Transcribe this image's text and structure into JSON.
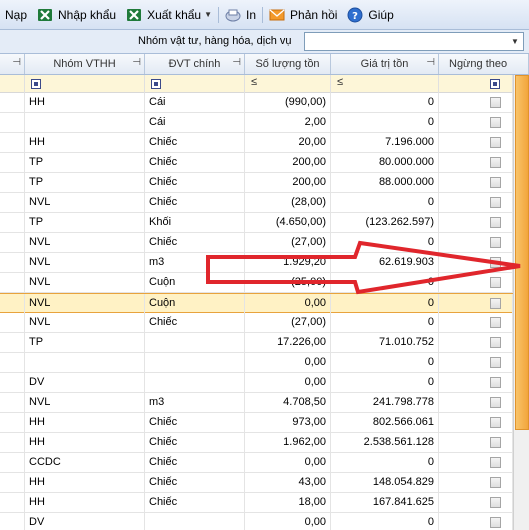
{
  "toolbar": {
    "items": [
      {
        "label": "Nạp",
        "icon": "none"
      },
      {
        "label": "Nhập khẩu",
        "icon": "excel-icon"
      },
      {
        "label": "Xuất khẩu",
        "icon": "excel-icon",
        "dropdown": true
      },
      {
        "label": "In",
        "icon": "print-icon"
      },
      {
        "label": "Phản hồi",
        "icon": "mail-icon"
      },
      {
        "label": "Giúp",
        "icon": "help-icon"
      }
    ]
  },
  "filter": {
    "label": "Nhóm vật tư, hàng hóa, dịch vụ",
    "value": ""
  },
  "columns": {
    "nhom": "Nhóm VTHH",
    "dvt": "ĐVT chính",
    "soluong": "Số lượng tồn",
    "giatri": "Giá trị tồn",
    "ngung": "Ngừng theo"
  },
  "filter_row": {
    "soluong_op": "≤",
    "giatri_op": "≤"
  },
  "rows": [
    {
      "nhom": "HH",
      "dvt": "Cái",
      "soluong": "(990,00)",
      "giatri": "0"
    },
    {
      "nhom": "",
      "dvt": "Cái",
      "soluong": "2,00",
      "giatri": "0"
    },
    {
      "nhom": "HH",
      "dvt": "Chiếc",
      "soluong": "20,00",
      "giatri": "7.196.000"
    },
    {
      "nhom": "TP",
      "dvt": "Chiếc",
      "soluong": "200,00",
      "giatri": "80.000.000"
    },
    {
      "nhom": "TP",
      "dvt": "Chiếc",
      "soluong": "200,00",
      "giatri": "88.000.000"
    },
    {
      "nhom": "NVL",
      "dvt": "Chiếc",
      "soluong": "(28,00)",
      "giatri": "0"
    },
    {
      "nhom": "TP",
      "dvt": "Khối",
      "soluong": "(4.650,00)",
      "giatri": "(123.262.597)"
    },
    {
      "nhom": "NVL",
      "dvt": "Chiếc",
      "soluong": "(27,00)",
      "giatri": "0"
    },
    {
      "nhom": "NVL",
      "dvt": "m3",
      "soluong": "1.929,20",
      "giatri": "62.619.903"
    },
    {
      "nhom": "NVL",
      "dvt": "Cuộn",
      "soluong": "(25,00)",
      "giatri": "0"
    },
    {
      "nhom": "NVL",
      "dvt": "Cuộn",
      "soluong": "0,00",
      "giatri": "0",
      "selected": true
    },
    {
      "nhom": "NVL",
      "dvt": "Chiếc",
      "soluong": "(27,00)",
      "giatri": "0"
    },
    {
      "nhom": "TP",
      "dvt": "",
      "soluong": "17.226,00",
      "giatri": "71.010.752"
    },
    {
      "nhom": "",
      "dvt": "",
      "soluong": "0,00",
      "giatri": "0"
    },
    {
      "nhom": "DV",
      "dvt": "",
      "soluong": "0,00",
      "giatri": "0"
    },
    {
      "nhom": "NVL",
      "dvt": "m3",
      "soluong": "4.708,50",
      "giatri": "241.798.778"
    },
    {
      "nhom": "HH",
      "dvt": "Chiếc",
      "soluong": "973,00",
      "giatri": "802.566.061"
    },
    {
      "nhom": "HH",
      "dvt": "Chiếc",
      "soluong": "1.962,00",
      "giatri": "2.538.561.128"
    },
    {
      "nhom": "CCDC",
      "dvt": "Chiếc",
      "soluong": "0,00",
      "giatri": "0"
    },
    {
      "nhom": "HH",
      "dvt": "Chiếc",
      "soluong": "43,00",
      "giatri": "148.054.829"
    },
    {
      "nhom": "HH",
      "dvt": "Chiếc",
      "soluong": "18,00",
      "giatri": "167.841.625"
    },
    {
      "nhom": "DV",
      "dvt": "",
      "soluong": "0,00",
      "giatri": "0"
    }
  ],
  "colors": {
    "accent": "#e8a33d",
    "annotation_arrow": "#e0262c",
    "scroll_thumb": "#f2a53b"
  }
}
